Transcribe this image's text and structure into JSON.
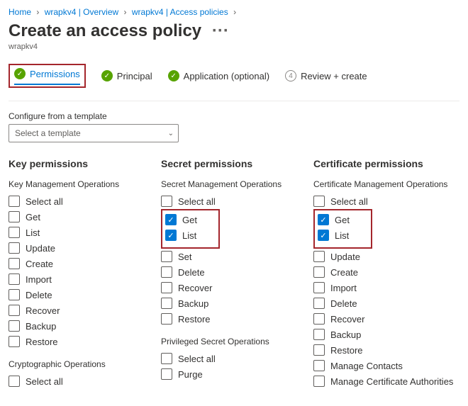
{
  "breadcrumb": {
    "home": "Home",
    "item1": "wrapkv4 | Overview",
    "item2": "wrapkv4 | Access policies"
  },
  "title": "Create an access policy",
  "subtitle": "wrapkv4",
  "steps": {
    "permissions": "Permissions",
    "principal": "Principal",
    "application": "Application (optional)",
    "review_num": "4",
    "review": "Review + create"
  },
  "template": {
    "label": "Configure from a template",
    "placeholder": "Select a template"
  },
  "key": {
    "heading": "Key permissions",
    "mgmt_label": "Key Management Operations",
    "select_all": "Select all",
    "items": [
      "Get",
      "List",
      "Update",
      "Create",
      "Import",
      "Delete",
      "Recover",
      "Backup",
      "Restore"
    ],
    "crypto_label": "Cryptographic Operations",
    "crypto_select_all": "Select all"
  },
  "secret": {
    "heading": "Secret permissions",
    "mgmt_label": "Secret Management Operations",
    "select_all": "Select all",
    "items": [
      "Get",
      "List",
      "Set",
      "Delete",
      "Recover",
      "Backup",
      "Restore"
    ],
    "checked": {
      "Get": true,
      "List": true
    },
    "priv_label": "Privileged Secret Operations",
    "priv_select_all": "Select all",
    "priv_items": [
      "Purge"
    ]
  },
  "cert": {
    "heading": "Certificate permissions",
    "mgmt_label": "Certificate Management Operations",
    "select_all": "Select all",
    "items": [
      "Get",
      "List",
      "Update",
      "Create",
      "Import",
      "Delete",
      "Recover",
      "Backup",
      "Restore",
      "Manage Contacts",
      "Manage Certificate Authorities"
    ],
    "checked": {
      "Get": true,
      "List": true
    }
  }
}
